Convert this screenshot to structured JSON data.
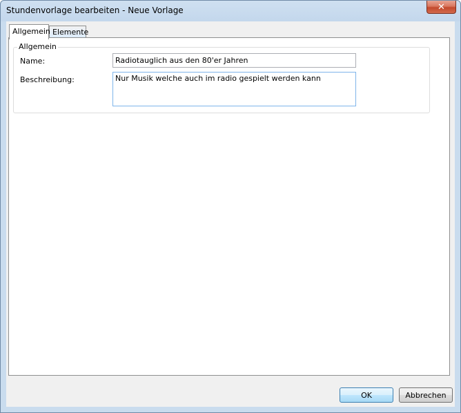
{
  "window": {
    "title": "Stundenvorlage bearbeiten - Neue Vorlage",
    "close_glyph": "✕"
  },
  "tabs": [
    {
      "label": "Allgemein",
      "active": true
    },
    {
      "label": "Elemente",
      "active": false
    }
  ],
  "group": {
    "legend": "Allgemein",
    "fields": {
      "name_label": "Name:",
      "name_value": "Radiotauglich aus den 80'er Jahren",
      "description_label": "Beschreibung:",
      "description_value": "Nur Musik welche auch im radio gespielt werden kann"
    }
  },
  "buttons": {
    "ok": "OK",
    "cancel": "Abbrechen"
  },
  "colors": {
    "title_bar": "#c3d7ec",
    "close_button": "#c34a2d",
    "default_button": "#a7d9f5"
  }
}
